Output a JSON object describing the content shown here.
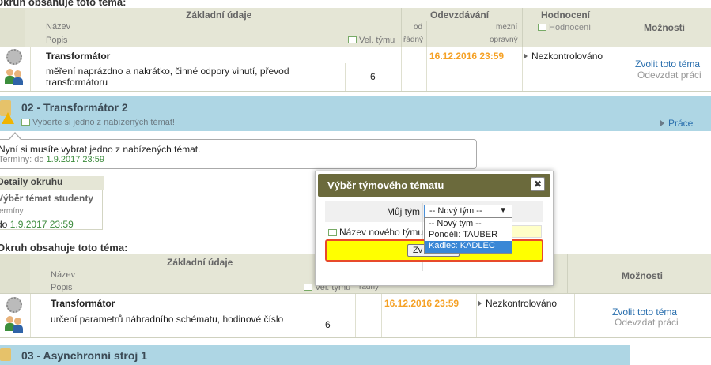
{
  "top_section": {
    "heading": "Okruh obsahuje toto téma:",
    "col_basic": "Základní údaje",
    "col_submission": "Odevzdávání",
    "col_rating": "Hodnocení",
    "col_options": "Možnosti",
    "sub_name": "Název",
    "sub_desc": "Popis",
    "sub_team_size": "Vel. týmu",
    "sub_from": "od",
    "sub_regular": "řádný",
    "sub_limit": "mezní",
    "sub_proper": "opravný",
    "sub_rating": "Hodnocení",
    "row": {
      "title": "Transformátor",
      "description": "měření naprázdno a nakrátko, činné odpory vinutí, převod transformátoru",
      "team_size": "6",
      "deadline": "16.12.2016 23:59",
      "status": "Nezkontrolováno",
      "action_choose": "Zvolit toto téma",
      "action_submit": "Odevzdat práci"
    }
  },
  "group2": {
    "title": "02 - Transformátor 2",
    "notice": "Vyberte si jedno z nabízených témat!",
    "work_link": "Práce",
    "info_text": "Nyní si musíte vybrat jedno z nabízených témat.",
    "terms_label": "Termíny: do",
    "terms_date": "1.9.2017 23:59",
    "details_title": "Detaily okruhu",
    "details_col": "Výběr témat studenty",
    "details_terms": "Termíny",
    "details_to": "do",
    "details_date": "1.9.2017 23:59"
  },
  "bottom_section": {
    "heading": "Okruh obsahuje toto téma:",
    "col_basic": "Základní údaje",
    "col_options": "Možnosti",
    "sub_name": "Název",
    "sub_desc": "Popis",
    "sub_team_size": "Vel. týmu",
    "sub_regular": "řádný",
    "row": {
      "title": "Transformátor",
      "description": "určení parametrů náhradního schématu, hodinové číslo",
      "team_size": "6",
      "deadline": "16.12.2016 23:59",
      "status": "Nezkontrolováno",
      "action_choose": "Zvolit toto téma",
      "action_submit": "Odevzdat práci"
    }
  },
  "group3": {
    "title": "03 - Asynchronní stroj 1"
  },
  "dialog": {
    "title": "Výběr týmového tématu",
    "close": "✖",
    "my_team_label": "Můj tým",
    "team_select_value": "-- Nový tým --",
    "new_team_label": "Název nového týmu",
    "submit_partial": "Zv",
    "dropdown_options": [
      "-- Nový tým --",
      "Pondělí: TAUBER",
      "Kadlec: KADLEC"
    ],
    "highlighted_option": "Kadlec: KADLEC"
  },
  "colors": {
    "header_bg": "#e5e6d6",
    "band_blue": "#aed6e4",
    "dialog_title_bg": "#6b6a3c",
    "deadline_orange": "#f5a125",
    "link_blue": "#2a6fae",
    "highlight_yellow": "#ffff00",
    "highlight_border": "#e84a2a",
    "option_selected": "#3a87d6"
  }
}
